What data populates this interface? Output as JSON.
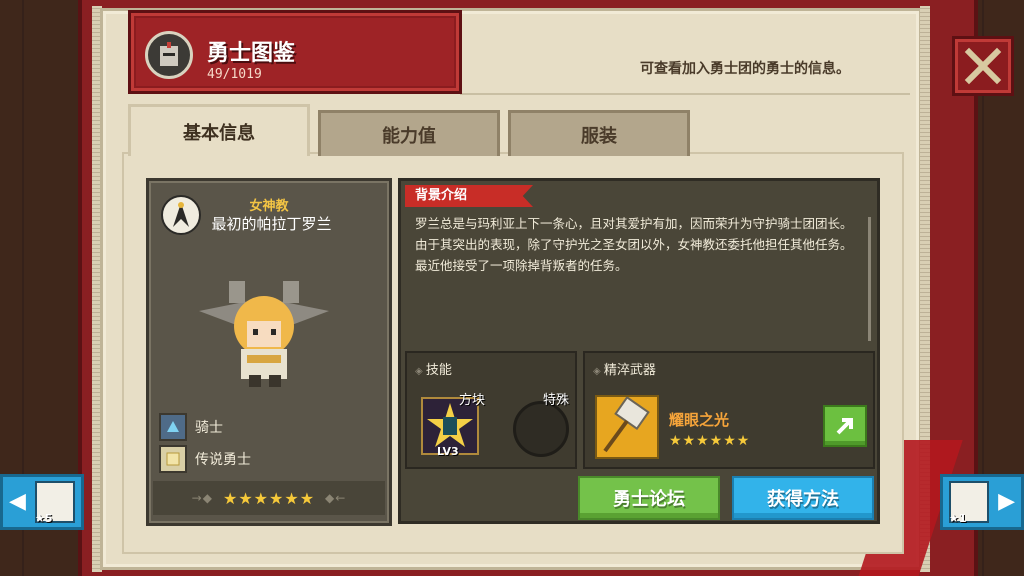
{
  "header": {
    "title": "勇士图鉴",
    "count": "49/1019",
    "subtitle": "可查看加入勇士团的勇士的信息。"
  },
  "tabs": [
    {
      "label": "基本信息",
      "active": true
    },
    {
      "label": "能力值",
      "active": false
    },
    {
      "label": "服装",
      "active": false
    }
  ],
  "hero": {
    "faith": "女神教",
    "name": "最初的帕拉丁罗兰",
    "roles": [
      {
        "label": "骑士",
        "icon": "knight-class-icon"
      },
      {
        "label": "传说勇士",
        "icon": "legend-rank-icon"
      }
    ],
    "stars": "★★★★★★"
  },
  "background": {
    "title": "背景介绍",
    "text": "罗兰总是与玛利亚上下一条心，且对其爱护有加，因而荣升为守护骑士团团长。由于其突出的表现，除了守护光之圣女团以外，女神教还委托他担任其他任务。最近他接受了一项除掉背叛者的任务。"
  },
  "skills": {
    "title": "技能",
    "skill_label": "方块",
    "skill_level": "LV3",
    "special_label": "特殊"
  },
  "weapon": {
    "title": "精淬武器",
    "name": "耀眼之光",
    "stars": "★★★★★★"
  },
  "buttons": {
    "forum": "勇士论坛",
    "obtain": "获得方法"
  },
  "nav": {
    "prev_stars": "★5",
    "next_stars": "★1"
  },
  "colors": {
    "accent_red": "#8b1c1f",
    "green_button": "#74c24a",
    "blue_button": "#32b3ea",
    "gold_text": "#f3c444"
  }
}
